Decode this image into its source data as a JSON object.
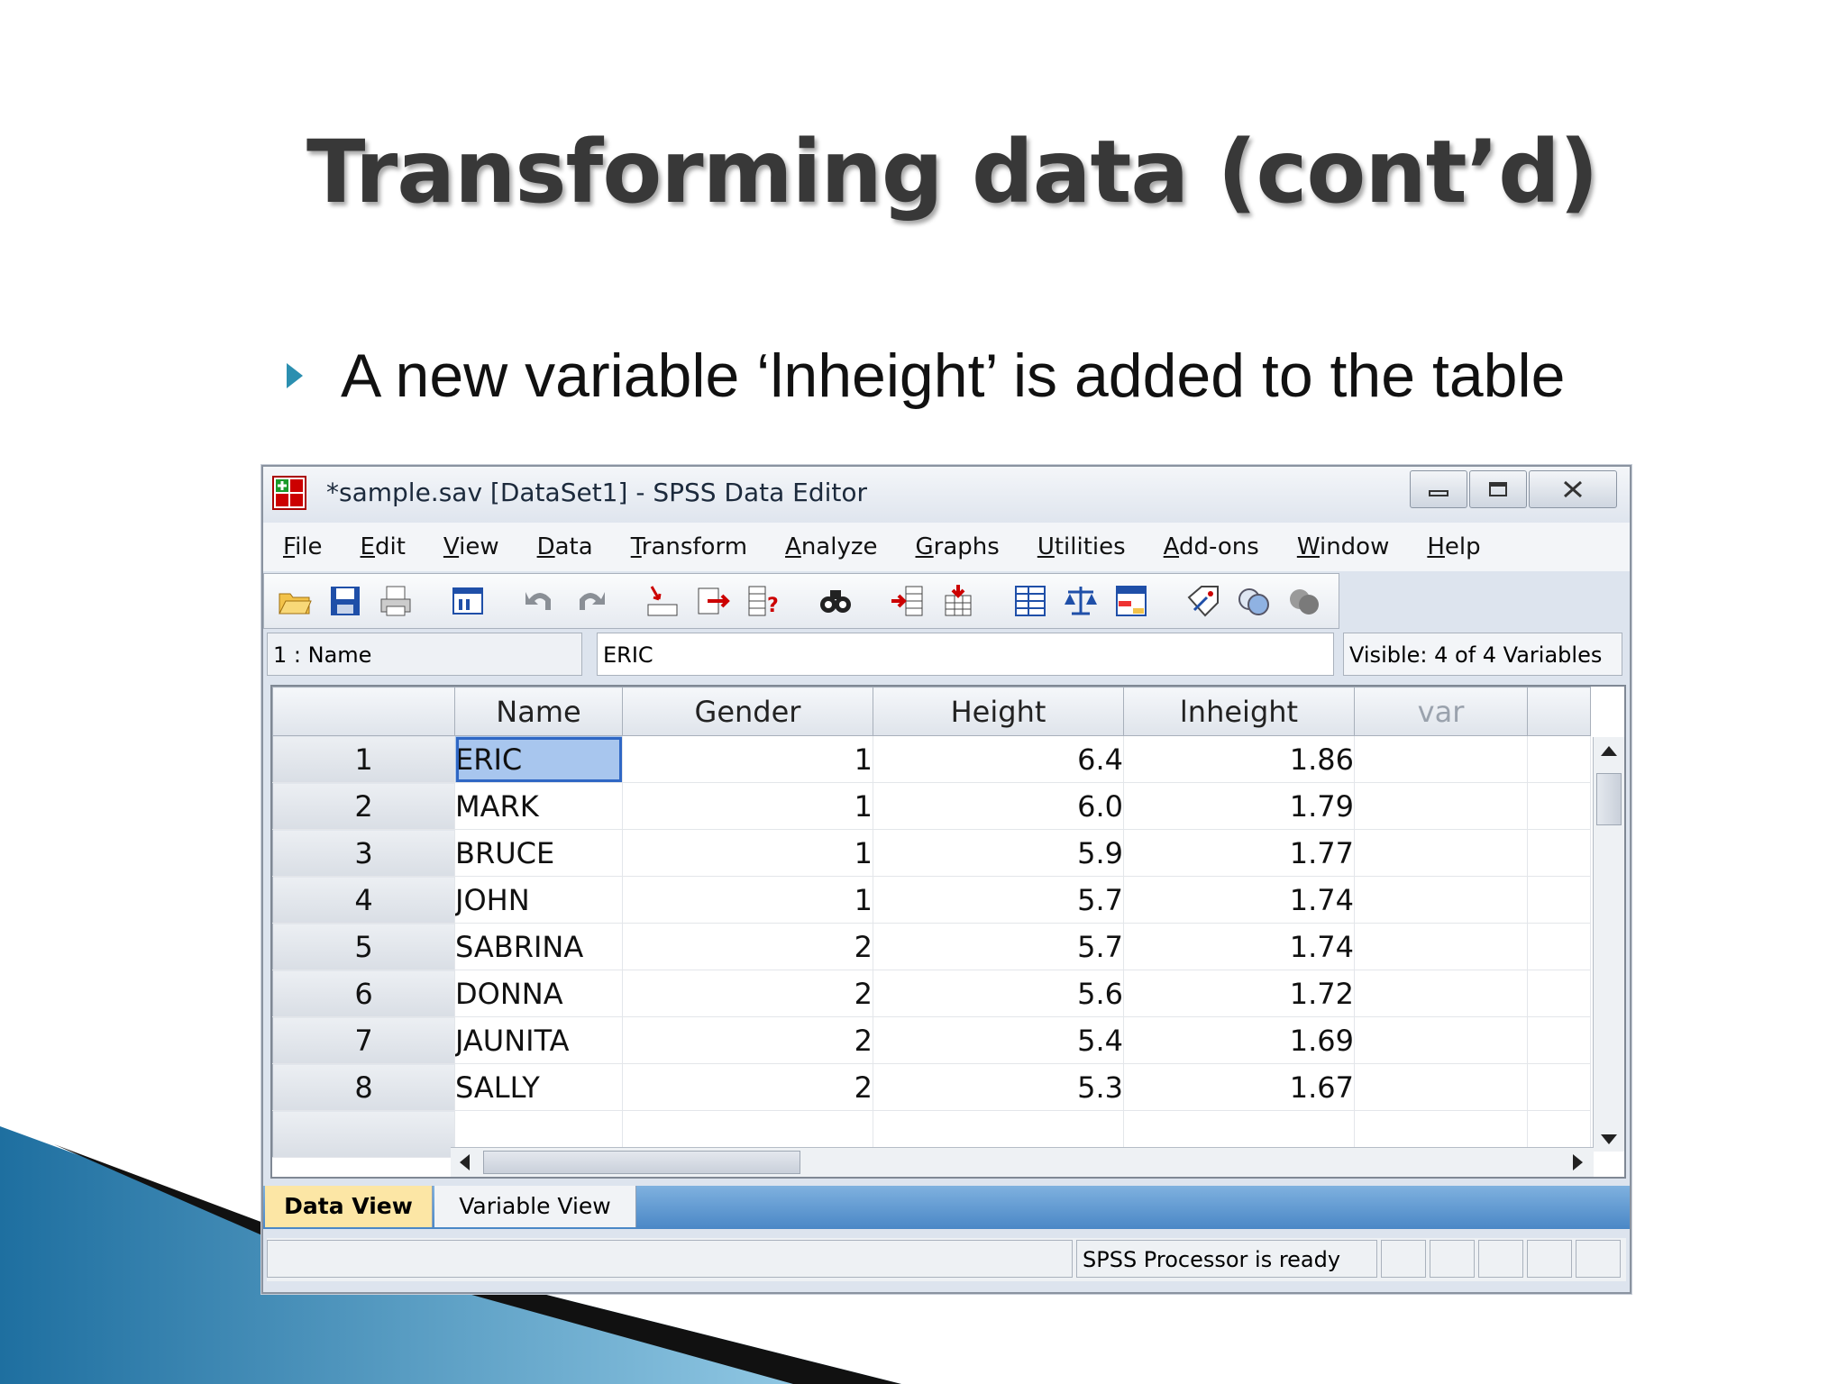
{
  "slide": {
    "title": "Transforming data (cont’d)",
    "bullet": "A new variable ‘lnheight’ is added to the table"
  },
  "window": {
    "title": "*sample.sav [DataSet1] - SPSS Data Editor",
    "menu": [
      "File",
      "Edit",
      "View",
      "Data",
      "Transform",
      "Analyze",
      "Graphs",
      "Utilities",
      "Add-ons",
      "Window",
      "Help"
    ],
    "toolbar_icons": [
      "open-icon",
      "save-icon",
      "print-icon",
      "dialog-recall-icon",
      "undo-icon",
      "redo-icon",
      "goto-case-icon",
      "goto-variable-icon",
      "variables-icon",
      "find-icon",
      "insert-cases-icon",
      "insert-variable-icon",
      "split-file-icon",
      "weight-cases-icon",
      "select-cases-icon",
      "value-labels-icon",
      "use-sets-icon",
      "show-all-variables-icon"
    ],
    "cell_ref": "1 : Name",
    "cell_value": "ERIC",
    "visible_vars": "Visible: 4 of 4 Variables",
    "columns": [
      "Name",
      "Gender",
      "Height",
      "lnheight",
      "var"
    ],
    "rows": [
      {
        "n": "1",
        "name": "ERIC",
        "gender": "1",
        "height": "6.4",
        "ln": "1.86"
      },
      {
        "n": "2",
        "name": "MARK",
        "gender": "1",
        "height": "6.0",
        "ln": "1.79"
      },
      {
        "n": "3",
        "name": "BRUCE",
        "gender": "1",
        "height": "5.9",
        "ln": "1.77"
      },
      {
        "n": "4",
        "name": "JOHN",
        "gender": "1",
        "height": "5.7",
        "ln": "1.74"
      },
      {
        "n": "5",
        "name": "SABRINA",
        "gender": "2",
        "height": "5.7",
        "ln": "1.74"
      },
      {
        "n": "6",
        "name": "DONNA",
        "gender": "2",
        "height": "5.6",
        "ln": "1.72"
      },
      {
        "n": "7",
        "name": "JAUNITA",
        "gender": "2",
        "height": "5.4",
        "ln": "1.69"
      },
      {
        "n": "8",
        "name": "SALLY",
        "gender": "2",
        "height": "5.3",
        "ln": "1.67"
      }
    ],
    "tabs": {
      "data_view": "Data View",
      "variable_view": "Variable View"
    },
    "status": "SPSS  Processor is ready"
  }
}
